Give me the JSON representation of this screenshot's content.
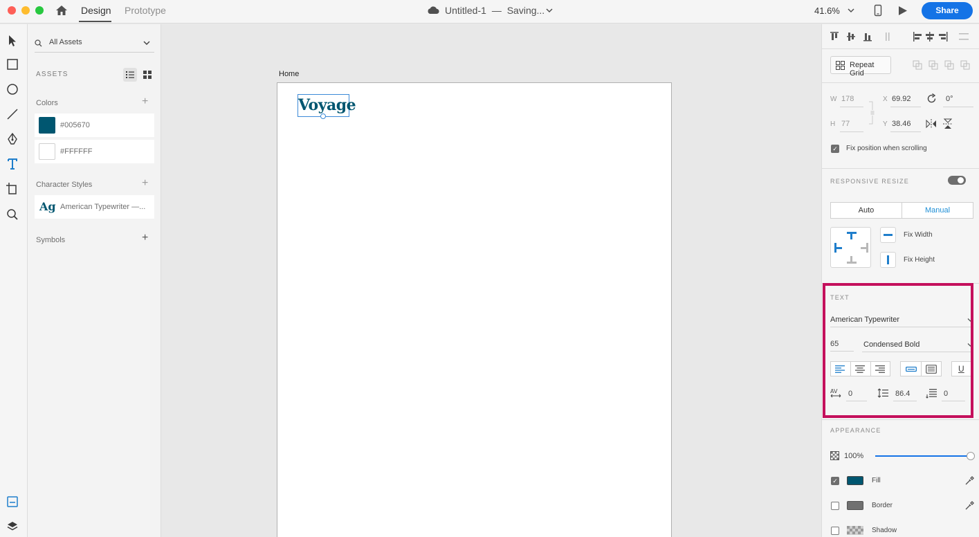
{
  "header": {
    "tabs": [
      {
        "label": "Design"
      },
      {
        "label": "Prototype"
      }
    ],
    "doc_title": "Untitled-1",
    "doc_sep": "—",
    "doc_status": "Saving...",
    "zoom": "41.6%",
    "share_label": "Share"
  },
  "assets": {
    "search_label": "All Assets",
    "section_title": "ASSETS",
    "colors_title": "Colors",
    "colors": [
      {
        "hex": "#005670",
        "label": "#005670"
      },
      {
        "hex": "#FFFFFF",
        "label": "#FFFFFF"
      }
    ],
    "char_styles_title": "Character Styles",
    "char_style": {
      "glyph": "Ag",
      "label": "American Typewriter —..."
    },
    "symbols_title": "Symbols"
  },
  "canvas": {
    "artboard_label": "Home",
    "text_object": "Voyage",
    "text_color": "#005670"
  },
  "inspector": {
    "repeat_grid": "Repeat Grid",
    "w_label": "W",
    "w_value": "178",
    "h_label": "H",
    "h_value": "77",
    "x_label": "X",
    "x_value": "69.92",
    "y_label": "Y",
    "y_value": "38.46",
    "rotation": "0°",
    "fix_position": "Fix position when scrolling",
    "responsive_title": "RESPONSIVE RESIZE",
    "resize_auto": "Auto",
    "resize_manual": "Manual",
    "fix_width": "Fix Width",
    "fix_height": "Fix Height",
    "text_title": "TEXT",
    "font_family": "American Typewriter",
    "font_size": "65",
    "font_weight": "Condensed Bold",
    "char_spacing": "0",
    "line_spacing": "86.4",
    "para_spacing": "0",
    "appearance_title": "APPEARANCE",
    "opacity": "100%",
    "opacity_level": 1.0,
    "fill_label": "Fill",
    "fill_color": "#005670",
    "border_label": "Border",
    "border_color": "#707070",
    "shadow_label": "Shadow"
  },
  "accent": "#1473e6",
  "highlight_color": "#c4105c"
}
